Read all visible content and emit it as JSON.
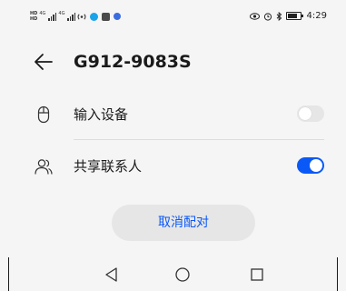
{
  "status_bar": {
    "sim1": "HD",
    "sim2": "HD",
    "network_tag_1": "4G",
    "network_tag_2": "4G",
    "time": "4:29",
    "battery_level": 0.8,
    "icons": [
      "sim-hd-icon",
      "signal-icon",
      "signal-icon",
      "hotspot-icon",
      "app-icon",
      "app-icon",
      "app-icon",
      "eye-icon",
      "alarm-icon",
      "bluetooth-icon",
      "battery-icon"
    ]
  },
  "header": {
    "title": "G912-9083S",
    "back_icon": "arrow-left-icon"
  },
  "settings": [
    {
      "icon": "mouse-icon",
      "label": "输入设备",
      "enabled": false
    },
    {
      "icon": "contacts-icon",
      "label": "共享联系人",
      "enabled": true
    }
  ],
  "actions": {
    "unpair_label": "取消配对"
  },
  "nav_bar": {
    "back_icon": "triangle-back-icon",
    "home_icon": "circle-home-icon",
    "recent_icon": "square-recent-icon"
  },
  "colors": {
    "accent": "#0a59f7",
    "background": "#f5f5f5",
    "toggle_off": "#e6e6e6",
    "button_bg": "#e6e6e6"
  }
}
